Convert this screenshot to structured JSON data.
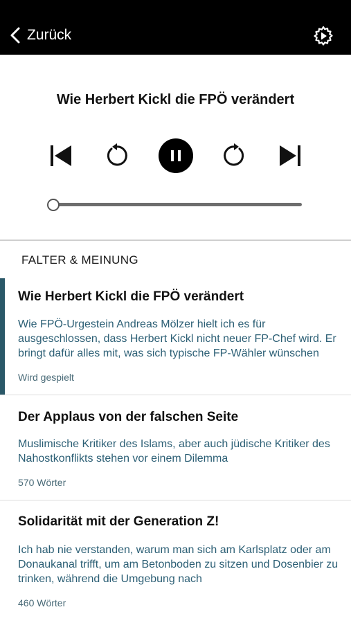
{
  "header": {
    "back_label": "Zurück"
  },
  "player": {
    "title": "Wie Herbert Kickl die FPÖ verändert",
    "progress": 0.0,
    "state": "playing"
  },
  "section": {
    "title": "FALTER & MEINUNG"
  },
  "articles": [
    {
      "title": "Wie Herbert Kickl die FPÖ verändert",
      "teaser": "Wie FPÖ-Urgestein Andreas Mölzer hielt ich es für ausgeschlossen, dass Herbert Kickl nicht neuer FP-Chef wird. Er bringt dafür alles mit, was sich typische FP-Wähler wünschen",
      "meta": "Wird gespielt",
      "active": true
    },
    {
      "title": "Der Applaus von der falschen Seite",
      "teaser": "Muslimische Kritiker des Islams, aber auch jüdische Kritiker des Nahostkonflikts stehen vor einem Dilemma",
      "meta": "570 Wörter",
      "active": false
    },
    {
      "title": "Solidarität mit der Generation Z!",
      "teaser": "Ich hab nie verstanden, warum man sich am Karlsplatz oder am Donaukanal trifft, um am Betonboden zu sitzen und Dosenbier zu trinken, während die Umgebung nach",
      "meta": "460 Wörter",
      "active": false
    }
  ],
  "colors": {
    "header_bg": "#000000",
    "accent": "#2a5868",
    "teaser_text": "#2c5f75"
  }
}
